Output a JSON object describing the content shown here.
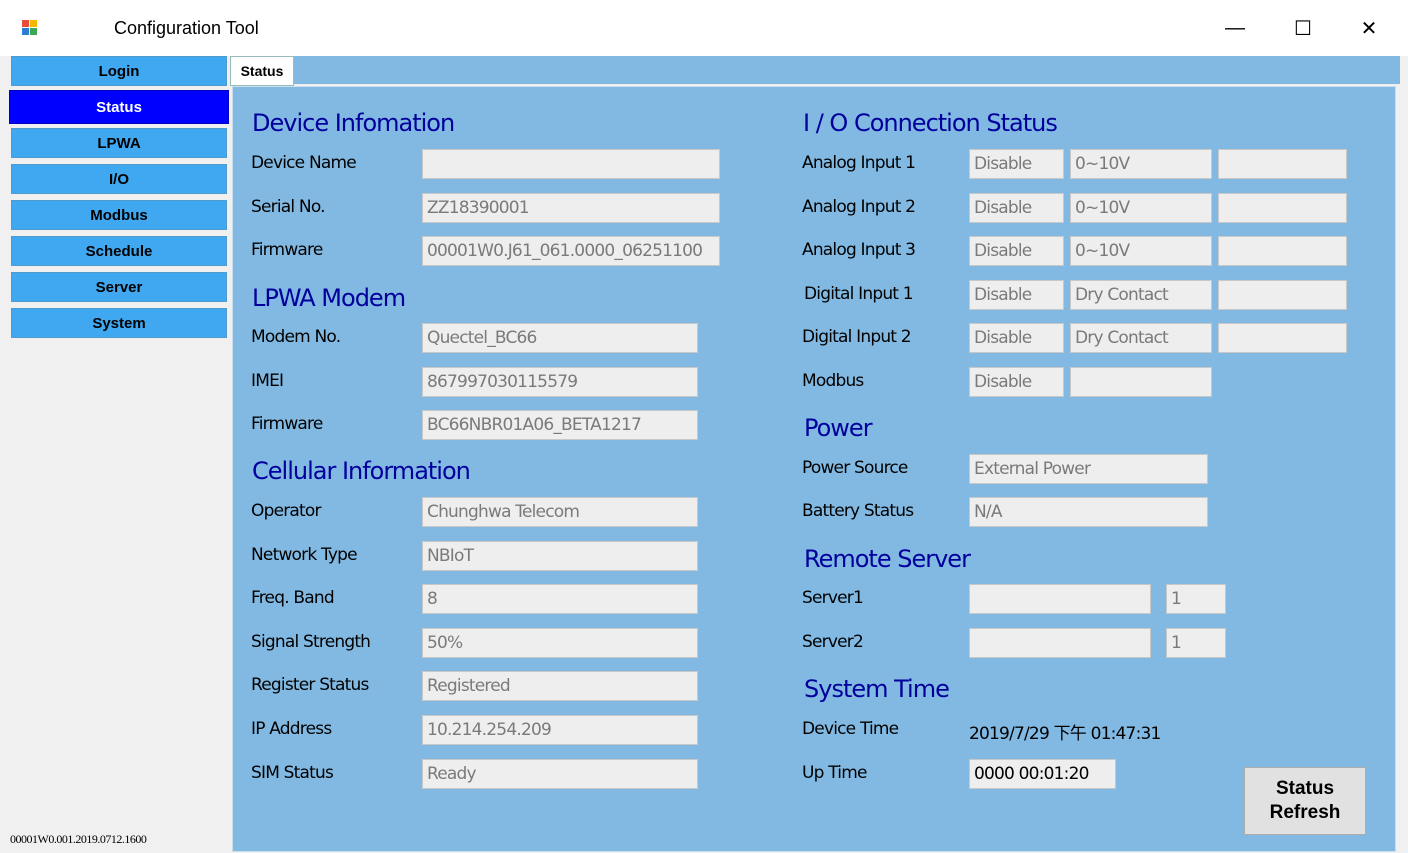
{
  "window": {
    "title": "Configuration Tool",
    "minimize": "—",
    "maximize": "☐",
    "close": "✕"
  },
  "sidebar": {
    "items": [
      {
        "label": "Login",
        "active": false
      },
      {
        "label": "Status",
        "active": true
      },
      {
        "label": "LPWA",
        "active": false
      },
      {
        "label": "I/O",
        "active": false
      },
      {
        "label": "Modbus",
        "active": false
      },
      {
        "label": "Schedule",
        "active": false
      },
      {
        "label": "Server",
        "active": false
      },
      {
        "label": "System",
        "active": false
      }
    ],
    "version": "00001W0.001.2019.0712.1600"
  },
  "tabs": [
    {
      "label": "Status"
    }
  ],
  "device_info": {
    "heading": "Device Infomation",
    "device_name_label": "Device Name",
    "device_name_value": "",
    "serial_label": "Serial No.",
    "serial_value": "ZZ18390001",
    "firmware_label": "Firmware",
    "firmware_value": "00001W0.J61_061.0000_06251100"
  },
  "lpwa_modem": {
    "heading": "LPWA Modem",
    "modem_label": "Modem No.",
    "modem_value": "Quectel_BC66",
    "imei_label": "IMEI",
    "imei_value": "867997030115579",
    "firmware_label": "Firmware",
    "firmware_value": "BC66NBR01A06_BETA1217"
  },
  "cellular": {
    "heading": "Cellular Information",
    "operator_label": "Operator",
    "operator_value": "Chunghwa Telecom",
    "network_label": "Network Type",
    "network_value": "NBIoT",
    "band_label": "Freq. Band",
    "band_value": "8",
    "signal_label": "Signal Strength",
    "signal_value": "50%",
    "register_label": "Register Status",
    "register_value": "Registered",
    "ip_label": "IP Address",
    "ip_value": "10.214.254.209",
    "sim_label": "SIM Status",
    "sim_value": "Ready"
  },
  "io": {
    "heading": "I / O Connection Status",
    "rows": [
      {
        "label": "Analog Input 1",
        "state": "Disable",
        "mode": "0~10V",
        "value": ""
      },
      {
        "label": "Analog Input 2",
        "state": "Disable",
        "mode": "0~10V",
        "value": ""
      },
      {
        "label": "Analog Input 3",
        "state": "Disable",
        "mode": "0~10V",
        "value": ""
      },
      {
        "label": "Digital Input 1",
        "state": "Disable",
        "mode": "Dry Contact",
        "value": ""
      },
      {
        "label": "Digital Input 2",
        "state": "Disable",
        "mode": "Dry Contact",
        "value": ""
      },
      {
        "label": "Modbus",
        "state": "Disable",
        "mode": ""
      }
    ]
  },
  "power": {
    "heading": "Power",
    "source_label": "Power Source",
    "source_value": "External Power",
    "battery_label": "Battery Status",
    "battery_value": "N/A"
  },
  "remote_server": {
    "heading": "Remote Server",
    "server1_label": "Server1",
    "server1_value": "",
    "server1_num": "1",
    "server2_label": "Server2",
    "server2_value": "",
    "server2_num": "1"
  },
  "system_time": {
    "heading": "System Time",
    "device_time_label": "Device Time",
    "device_time_value": "2019/7/29 下午 01:47:31",
    "uptime_label": "Up Time",
    "uptime_value": "0000 00:01:20"
  },
  "buttons": {
    "refresh": "Status Refresh"
  }
}
